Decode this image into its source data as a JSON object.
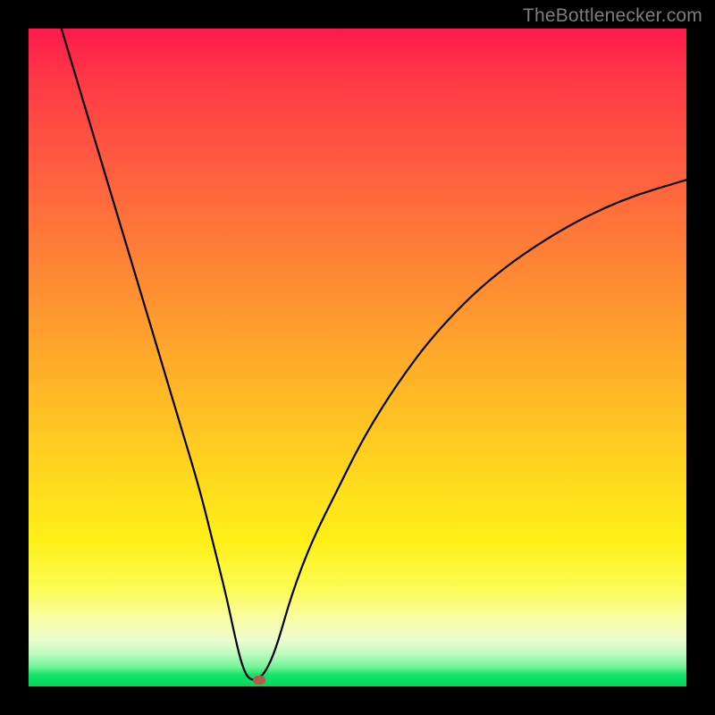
{
  "watermark": {
    "text": "TheBottlenecker.com"
  },
  "chart_data": {
    "type": "line",
    "title": "",
    "xlabel": "",
    "ylabel": "",
    "xlim": [
      0,
      100
    ],
    "ylim": [
      0,
      100
    ],
    "curve_points": [
      {
        "x": 5,
        "y": 100
      },
      {
        "x": 8,
        "y": 90
      },
      {
        "x": 11,
        "y": 80
      },
      {
        "x": 14,
        "y": 70
      },
      {
        "x": 17,
        "y": 60
      },
      {
        "x": 20,
        "y": 50
      },
      {
        "x": 23,
        "y": 40
      },
      {
        "x": 26,
        "y": 30
      },
      {
        "x": 28,
        "y": 22
      },
      {
        "x": 30,
        "y": 14
      },
      {
        "x": 31.5,
        "y": 7
      },
      {
        "x": 32.5,
        "y": 3
      },
      {
        "x": 33.5,
        "y": 1
      },
      {
        "x": 35,
        "y": 1
      },
      {
        "x": 36.5,
        "y": 3
      },
      {
        "x": 38,
        "y": 7
      },
      {
        "x": 40,
        "y": 14
      },
      {
        "x": 43,
        "y": 22
      },
      {
        "x": 47,
        "y": 30
      },
      {
        "x": 51,
        "y": 38
      },
      {
        "x": 56,
        "y": 46
      },
      {
        "x": 62,
        "y": 54
      },
      {
        "x": 70,
        "y": 62
      },
      {
        "x": 80,
        "y": 69
      },
      {
        "x": 90,
        "y": 74
      },
      {
        "x": 100,
        "y": 77
      }
    ],
    "marker": {
      "x": 35,
      "y": 1,
      "color": "#b85a4a"
    },
    "gradient_stops": [
      {
        "pos": 0,
        "color": "#ff1a4c"
      },
      {
        "pos": 50,
        "color": "#ffba26"
      },
      {
        "pos": 85,
        "color": "#fcfc54"
      },
      {
        "pos": 100,
        "color": "#03d65c"
      }
    ]
  }
}
